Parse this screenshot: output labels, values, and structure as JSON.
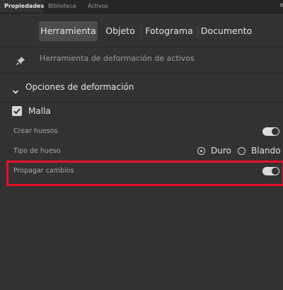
{
  "panel_tabs": [
    "Propiedades",
    "Biblioteca",
    "Activos"
  ],
  "panel_menu": "≡",
  "mode_tabs": [
    "Herramienta",
    "Objeto",
    "Fotograma",
    "Documento"
  ],
  "tool": {
    "name": "Herramienta de deformación de activos",
    "icon": "pin-icon"
  },
  "section": {
    "title": "Opciones de deformación",
    "icon": "chevron-down-icon"
  },
  "options": {
    "mesh": {
      "label": "Malla",
      "checked": true
    },
    "create_bones": {
      "label": "Crear huesos",
      "enabled": true
    },
    "bone_type": {
      "label": "Tipo de hueso",
      "options": [
        "Duro",
        "Blando"
      ],
      "selected": "Duro"
    },
    "propagate": {
      "label": "Propagar cambios",
      "enabled": true
    }
  },
  "colors": {
    "highlight": "#e8102b",
    "background": "#323232"
  }
}
